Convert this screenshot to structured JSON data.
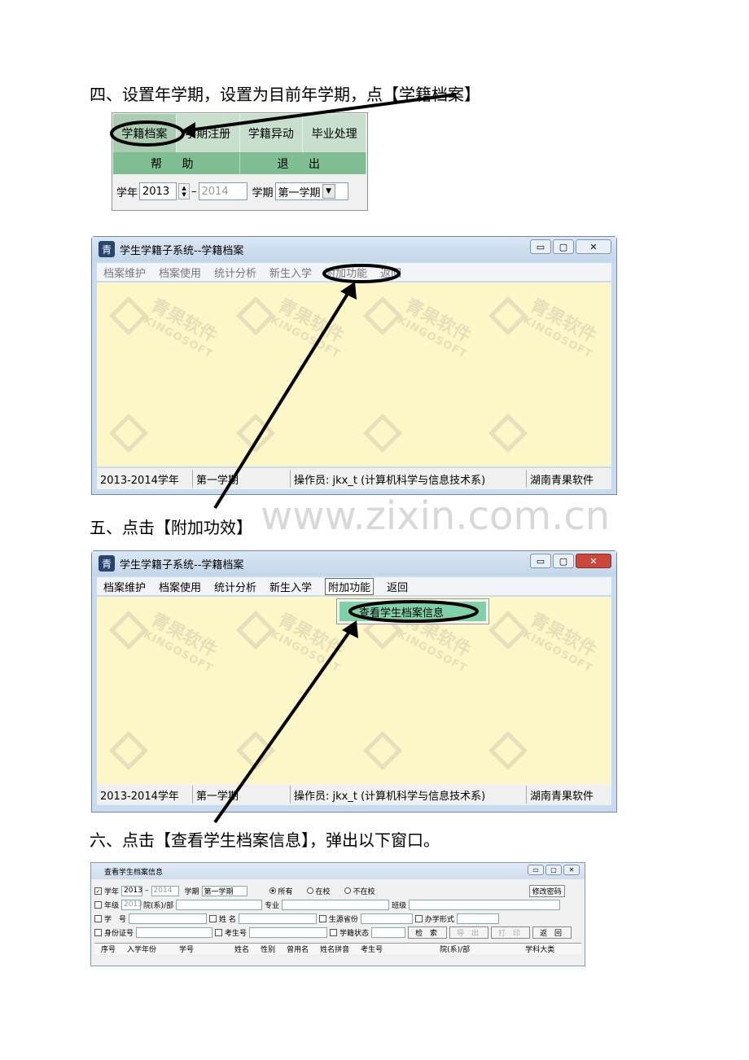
{
  "steps": {
    "step4": "四、设置年学期，设置为目前年学期，点【学籍档案】",
    "step5": "五、点击【附加功效】",
    "step6": "六、点击【查看学生档案信息】，弹出以下窗口。"
  },
  "site_watermark": "www.zixin.com.cn",
  "toolbar": {
    "buttons": [
      "学籍档案",
      "学期注册",
      "学籍异动",
      "毕业处理"
    ],
    "help": "帮 助",
    "exit": "退 出",
    "year_label": "学年",
    "year_start": "2013",
    "year_sep": "–",
    "year_end": "2014",
    "term_label": "学期",
    "term_value": "第一学期"
  },
  "app": {
    "title": "学生学籍子系统--学籍档案",
    "logo_glyph": "青",
    "menu": [
      "档案维护",
      "档案使用",
      "统计分析",
      "新生入学",
      "附加功能",
      "返回"
    ],
    "watermark_cn": "青果软件",
    "watermark_en": "KINGOSOFT",
    "status_year": "2013-2014学年",
    "status_term": "第一学期",
    "status_operator": "操作员: jkx_t (计算机科学与信息技术系)",
    "status_company": "湖南青果软件",
    "dropdown_item": "查看学生档案信息"
  },
  "dialog": {
    "title": "查看学生档案信息",
    "year_label": "学年",
    "year_start": "2013",
    "year_end": "2014",
    "term_label": "学期",
    "term_value": "第一学期",
    "radio_all": "所有",
    "radio_in": "在校",
    "radio_out": "不在校",
    "change_pwd": "修改密码",
    "grade_label": "年级",
    "grade_value": "2013",
    "dept_label": "院(系)/部",
    "major_label": "专业",
    "class_label": "班级",
    "student_no_label": "学　号",
    "name_label": "姓 名",
    "province_label": "生源省份",
    "school_form_label": "办学形式",
    "id_label": "身份证号",
    "exam_no_label": "考生号",
    "status_label": "学籍状态",
    "btn_search": "检 索",
    "btn_export": "导 出",
    "btn_print": "打 印",
    "btn_back": "返 回",
    "columns": [
      "序号",
      "入学年份",
      "学号",
      "姓名",
      "性别",
      "曾用名",
      "姓名拼音",
      "考生号",
      "院(系)/部",
      "学科大类"
    ]
  },
  "colors": {
    "toolbar_green": "#c7dfcc",
    "toolbar_dark_green": "#7fbd93",
    "client_yellow": "#fdf6c6",
    "menu_highlight": "#7fd1a8"
  }
}
